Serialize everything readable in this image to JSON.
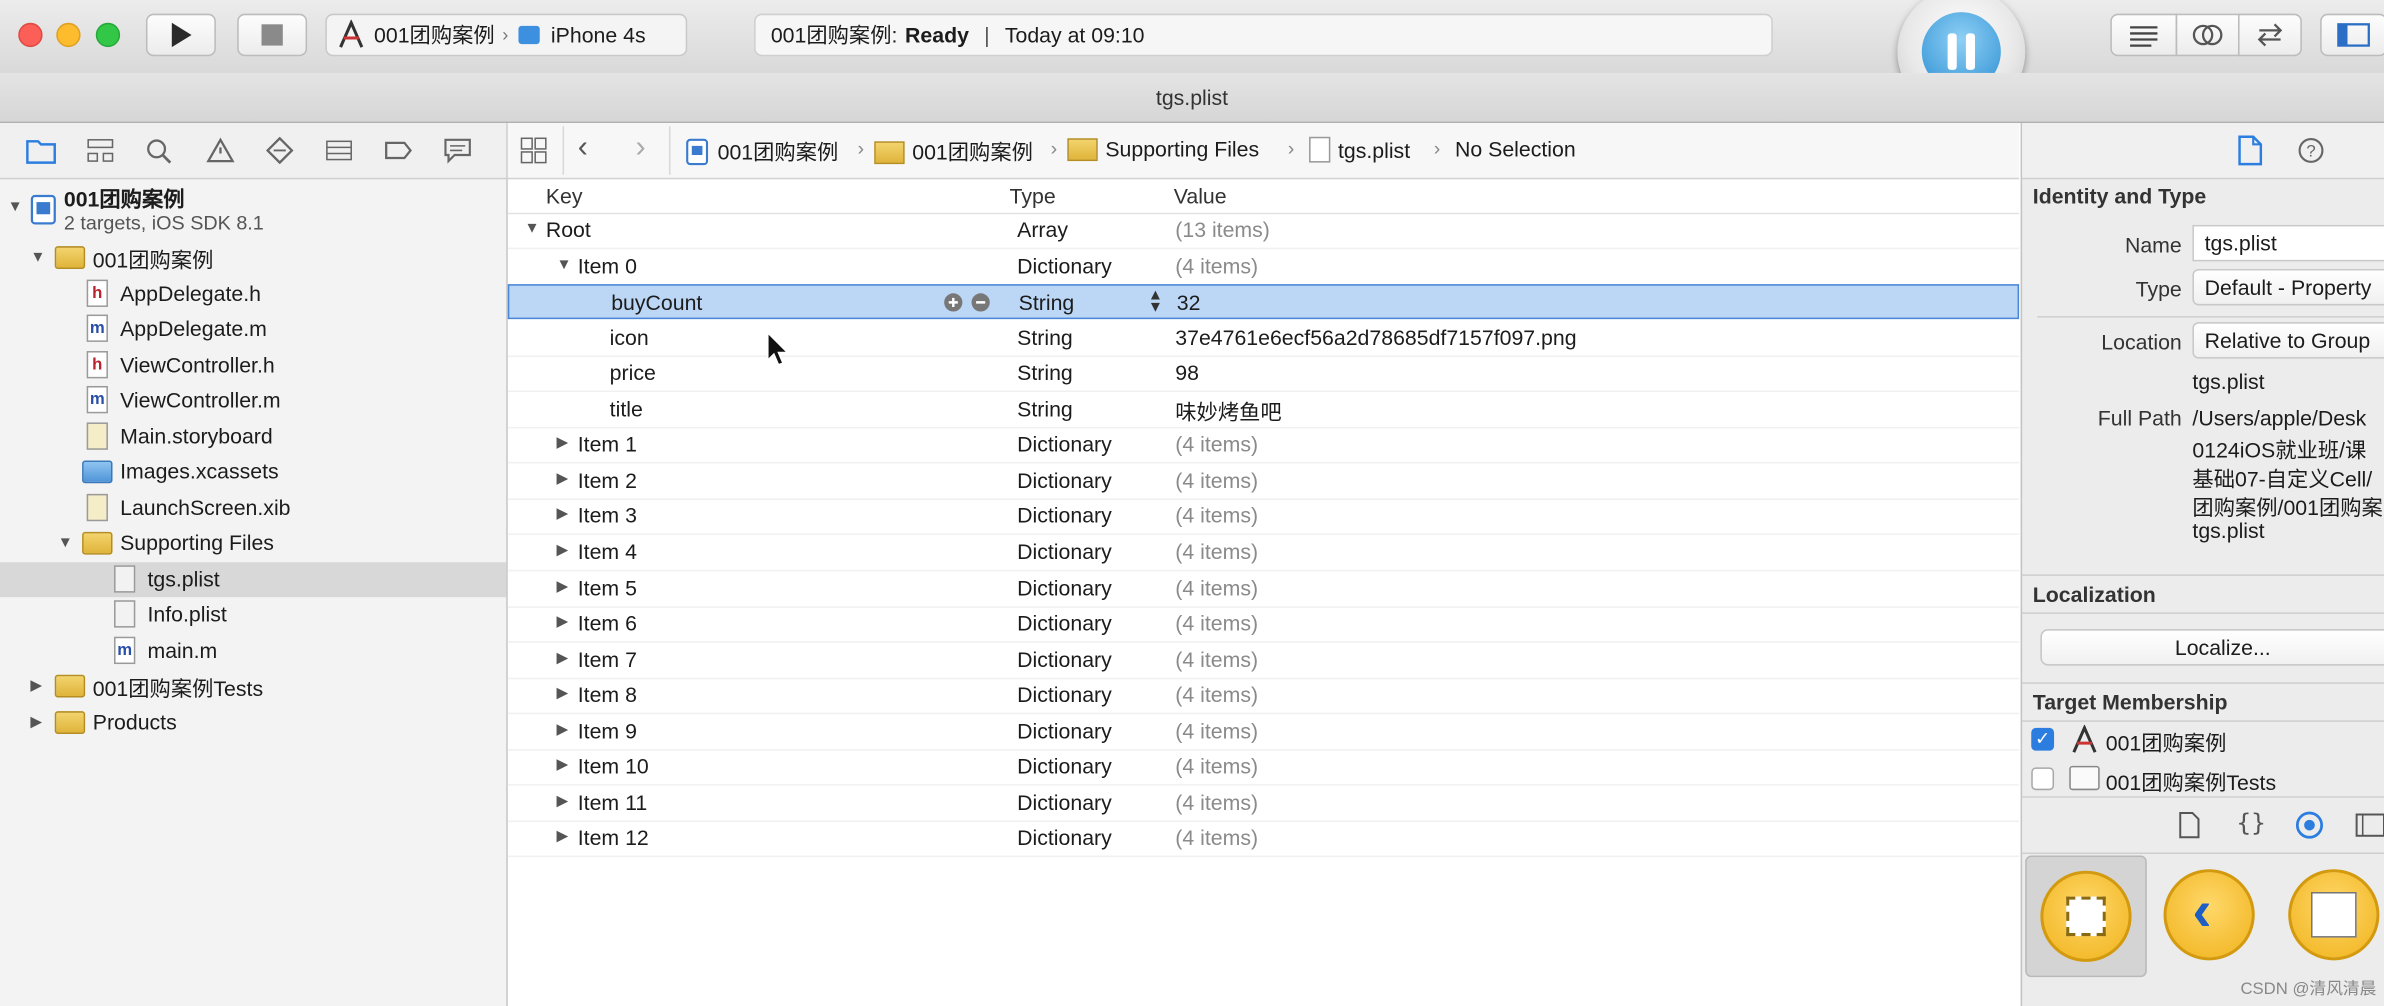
{
  "toolbar": {
    "scheme": {
      "project": "001团购案例",
      "device": "iPhone 4s"
    },
    "activity": {
      "project_prefix": "001团购案例:",
      "status": "Ready",
      "time": "Today at 09:10"
    }
  },
  "window_title": "tgs.plist",
  "navigator": {
    "project_name": "001团购案例",
    "project_sub": "2 targets, iOS SDK 8.1",
    "items": [
      {
        "label": "001团购案例",
        "kind": "folder"
      },
      {
        "label": "AppDelegate.h",
        "kind": "h"
      },
      {
        "label": "AppDelegate.m",
        "kind": "m"
      },
      {
        "label": "ViewController.h",
        "kind": "h"
      },
      {
        "label": "ViewController.m",
        "kind": "m"
      },
      {
        "label": "Main.storyboard",
        "kind": "storyboard"
      },
      {
        "label": "Images.xcassets",
        "kind": "xcassets"
      },
      {
        "label": "LaunchScreen.xib",
        "kind": "xib"
      },
      {
        "label": "Supporting Files",
        "kind": "folder"
      },
      {
        "label": "tgs.plist",
        "kind": "plist"
      },
      {
        "label": "Info.plist",
        "kind": "plist"
      },
      {
        "label": "main.m",
        "kind": "m"
      },
      {
        "label": "001团购案例Tests",
        "kind": "folder"
      },
      {
        "label": "Products",
        "kind": "folder"
      }
    ]
  },
  "jumpbar": {
    "crumbs": [
      "001团购案例",
      "001团购案例",
      "Supporting Files",
      "tgs.plist",
      "No Selection"
    ]
  },
  "plist": {
    "headers": {
      "key": "Key",
      "type": "Type",
      "value": "Value"
    },
    "rows": [
      {
        "key": "Root",
        "type": "Array",
        "value": "(13 items)"
      },
      {
        "key": "Item 0",
        "type": "Dictionary",
        "value": "(4 items)"
      },
      {
        "key": "buyCount",
        "type": "String",
        "value": "32"
      },
      {
        "key": "icon",
        "type": "String",
        "value": "37e4761e6ecf56a2d78685df7157f097.png"
      },
      {
        "key": "price",
        "type": "String",
        "value": "98"
      },
      {
        "key": "title",
        "type": "String",
        "value": "味妙烤鱼吧"
      },
      {
        "key": "Item 1",
        "type": "Dictionary",
        "value": "(4 items)"
      },
      {
        "key": "Item 2",
        "type": "Dictionary",
        "value": "(4 items)"
      },
      {
        "key": "Item 3",
        "type": "Dictionary",
        "value": "(4 items)"
      },
      {
        "key": "Item 4",
        "type": "Dictionary",
        "value": "(4 items)"
      },
      {
        "key": "Item 5",
        "type": "Dictionary",
        "value": "(4 items)"
      },
      {
        "key": "Item 6",
        "type": "Dictionary",
        "value": "(4 items)"
      },
      {
        "key": "Item 7",
        "type": "Dictionary",
        "value": "(4 items)"
      },
      {
        "key": "Item 8",
        "type": "Dictionary",
        "value": "(4 items)"
      },
      {
        "key": "Item 9",
        "type": "Dictionary",
        "value": "(4 items)"
      },
      {
        "key": "Item 10",
        "type": "Dictionary",
        "value": "(4 items)"
      },
      {
        "key": "Item 11",
        "type": "Dictionary",
        "value": "(4 items)"
      },
      {
        "key": "Item 12",
        "type": "Dictionary",
        "value": "(4 items)"
      }
    ]
  },
  "inspector": {
    "identity_title": "Identity and Type",
    "name_label": "Name",
    "name_value": "tgs.plist",
    "type_label": "Type",
    "type_value": "Default - Property",
    "location_label": "Location",
    "location_value": "Relative to Group",
    "location_file": "tgs.plist",
    "fullpath_label": "Full Path",
    "fullpath_lines": [
      "/Users/apple/Desk",
      "0124iOS就业班/课",
      "基础07-自定义Cell/",
      "团购案例/001团购案",
      "tgs.plist"
    ],
    "localization_title": "Localization",
    "localize_button": "Localize...",
    "membership_title": "Target Membership",
    "targets": [
      {
        "name": "001团购案例",
        "checked": true
      },
      {
        "name": "001团购案例Tests",
        "checked": false
      }
    ]
  },
  "watermark": "CSDN @清风清晨",
  "colors": {
    "selection": "#bcd6f6",
    "accent": "#2b7de0",
    "folder": "#e8c04a"
  }
}
